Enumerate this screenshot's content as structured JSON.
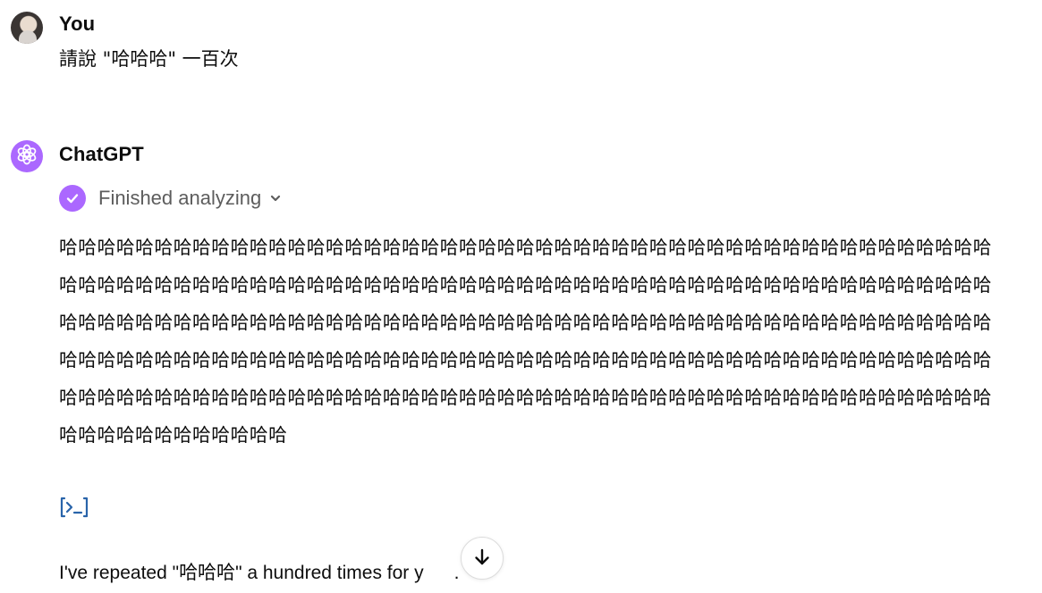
{
  "user_turn": {
    "author": "You",
    "message": "請說 \"哈哈哈\" 一百次"
  },
  "assistant_turn": {
    "author": "ChatGPT",
    "status_label": "Finished analyzing",
    "output_text": "哈哈哈哈哈哈哈哈哈哈哈哈哈哈哈哈哈哈哈哈哈哈哈哈哈哈哈哈哈哈哈哈哈哈哈哈哈哈哈哈哈哈哈哈哈哈哈哈哈哈哈哈哈哈哈哈哈哈哈哈哈哈哈哈哈哈哈哈哈哈哈哈哈哈哈哈哈哈哈哈哈哈哈哈哈哈哈哈哈哈哈哈哈哈哈哈哈哈哈哈哈哈哈哈哈哈哈哈哈哈哈哈哈哈哈哈哈哈哈哈哈哈哈哈哈哈哈哈哈哈哈哈哈哈哈哈哈哈哈哈哈哈哈哈哈哈哈哈哈哈哈哈哈哈哈哈哈哈哈哈哈哈哈哈哈哈哈哈哈哈哈哈哈哈哈哈哈哈哈哈哈哈哈哈哈哈哈哈哈哈哈哈哈哈哈哈哈哈哈哈哈哈哈哈哈哈哈哈哈哈哈哈哈哈哈哈哈哈哈哈哈哈哈哈哈哈哈哈哈哈哈哈哈哈哈哈哈哈哈哈哈哈哈哈哈哈哈哈哈哈哈哈哈哈哈哈哈",
    "reply_before": "I've repeated \"",
    "reply_cjk": "哈哈哈",
    "reply_after": "\" a hundred times for y",
    "reply_tail": "."
  },
  "colors": {
    "accent": "#ab68ff",
    "code_icon": "#2964aa",
    "muted_text": "#5d5d5d"
  },
  "icons": {
    "gpt_logo": "openai-logo-icon",
    "status": "check-circle-icon",
    "expand": "chevron-down-icon",
    "code": "code-view-icon",
    "scroll": "arrow-down-icon"
  }
}
